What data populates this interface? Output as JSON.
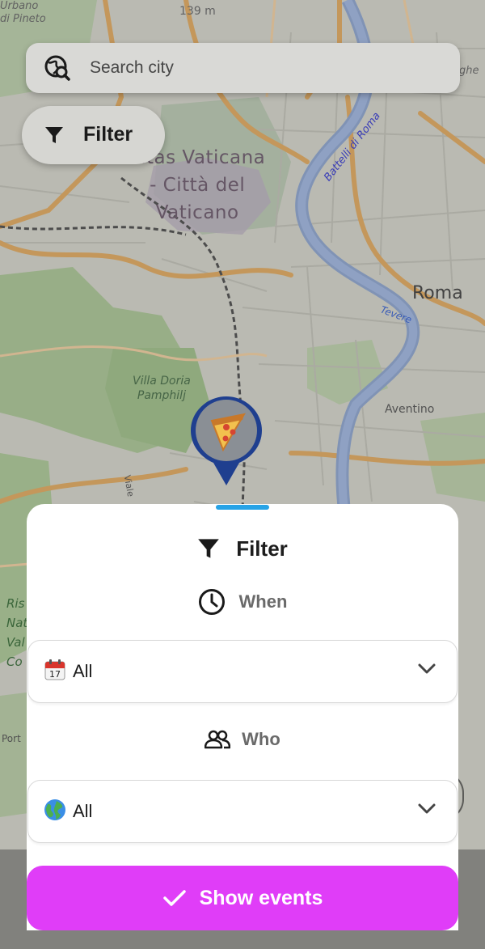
{
  "map": {
    "labels": {
      "vatican": "Civitas Vaticana - Città del Vaticano",
      "vatican_line1": "vitas Vaticana",
      "vatican_line2": "- Città del",
      "vatican_line3": "Vaticano",
      "roma": "Roma",
      "aventino": "Aventino",
      "villa_line1": "Villa Doria",
      "villa_line2": "Pamphilj",
      "tevere": "Tevere",
      "battelli": "Battelli di Roma",
      "altitude": "139 m",
      "port": "Port",
      "corner_line1": "Urbano",
      "corner_line2": "di Pineto",
      "ghe": "ghe",
      "ris_line1": "Ris",
      "ris_line2": "Nat",
      "ris_line3": "Val",
      "ris_line4": "Co",
      "viale": "Viale"
    },
    "marker": {
      "emoji": "🍕",
      "ring_color": "#1f3f8f"
    }
  },
  "search": {
    "placeholder": "Search city",
    "icon": "globe-search-icon"
  },
  "filter_chip": {
    "label": "Filter",
    "icon": "filter-funnel-icon"
  },
  "sheet": {
    "title": "Filter",
    "handle_color": "#27a3e6",
    "when": {
      "label": "When",
      "icon": "clock-icon",
      "selected": {
        "emoji": "📅",
        "value": "All"
      }
    },
    "who": {
      "label": "Who",
      "icon": "people-icon",
      "selected": {
        "emoji": "🌍",
        "value": "All"
      }
    }
  },
  "show_button": {
    "label": "Show events",
    "icon": "check-icon",
    "color": "#e03df8"
  }
}
